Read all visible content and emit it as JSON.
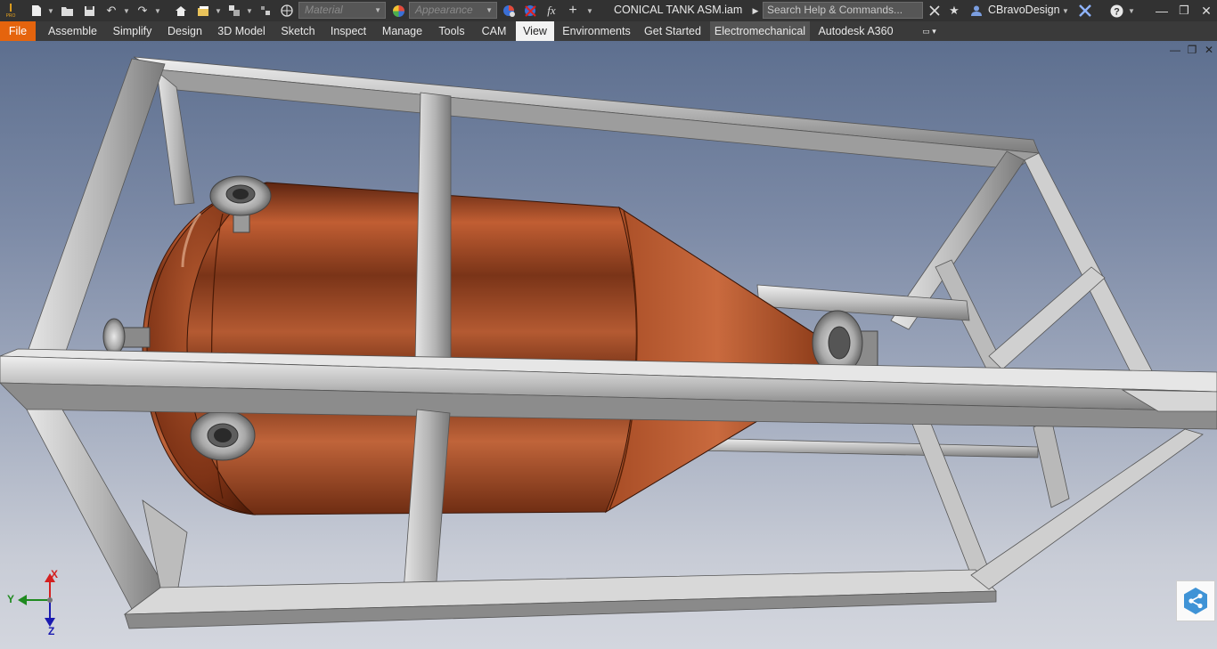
{
  "app": {
    "logo_text": "I",
    "logo_sub": "PRO"
  },
  "quick_access": {
    "material_placeholder": "Material",
    "appearance_placeholder": "Appearance",
    "fx_label": "fx"
  },
  "document": {
    "title": "CONICAL TANK ASM.iam"
  },
  "search": {
    "placeholder": "Search Help & Commands..."
  },
  "user": {
    "name": "CBravoDesign"
  },
  "tabs": [
    {
      "label": "File"
    },
    {
      "label": "Assemble"
    },
    {
      "label": "Simplify"
    },
    {
      "label": "Design"
    },
    {
      "label": "3D Model"
    },
    {
      "label": "Sketch"
    },
    {
      "label": "Inspect"
    },
    {
      "label": "Manage"
    },
    {
      "label": "Tools"
    },
    {
      "label": "CAM"
    },
    {
      "label": "View"
    },
    {
      "label": "Environments"
    },
    {
      "label": "Get Started"
    },
    {
      "label": "Electromechanical"
    },
    {
      "label": "Autodesk A360"
    }
  ],
  "active_tab": "View",
  "triad": {
    "x_label": "X",
    "y_label": "Y",
    "z_label": "Z"
  },
  "colors": {
    "file_tab": "#e5640d",
    "tank_copper": "#b3532a",
    "frame_steel": "#c8c8c8",
    "x_axis": "#d42020",
    "y_axis": "#1f8a1f",
    "z_axis": "#1a1ab0"
  }
}
